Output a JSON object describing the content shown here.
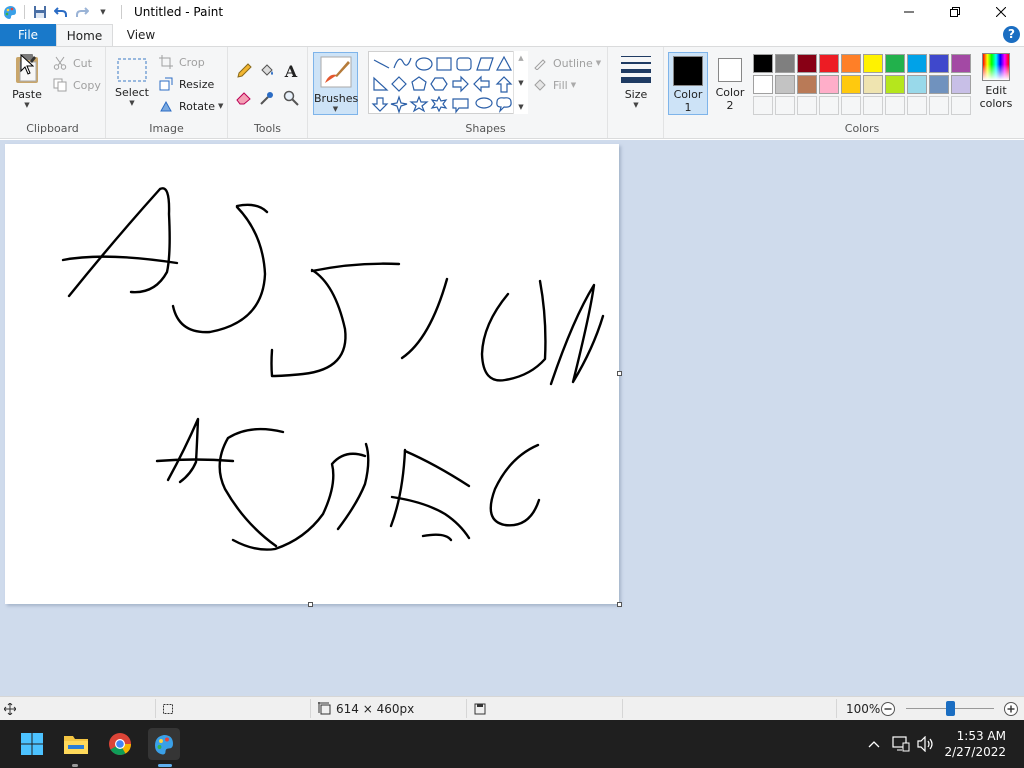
{
  "window": {
    "title": "Untitled - Paint"
  },
  "tabs": {
    "file": "File",
    "home": "Home",
    "view": "View",
    "help": "?"
  },
  "clipboard": {
    "paste": "Paste",
    "cut": "Cut",
    "copy": "Copy",
    "label": "Clipboard"
  },
  "image": {
    "select": "Select",
    "crop": "Crop",
    "resize": "Resize",
    "rotate": "Rotate",
    "label": "Image"
  },
  "tools": {
    "label": "Tools",
    "text_tool": "A"
  },
  "brushes": {
    "label": "Brushes"
  },
  "shapes": {
    "label": "Shapes",
    "outline": "Outline",
    "fill": "Fill"
  },
  "size": {
    "label": "Size"
  },
  "colors": {
    "color1_line1": "Color",
    "color1_line2": "1",
    "color2_line1": "Color",
    "color2_line2": "2",
    "edit_line1": "Edit",
    "edit_line2": "colors",
    "label": "Colors",
    "color1": "#000000",
    "color2": "#ffffff",
    "palette_row1": [
      "#000000",
      "#7f7f7f",
      "#880015",
      "#ed1c24",
      "#ff7f27",
      "#fff200",
      "#22b14c",
      "#00a2e8",
      "#3f48cc",
      "#a349a4"
    ],
    "palette_row2": [
      "#ffffff",
      "#c3c3c3",
      "#b97a57",
      "#ffaec9",
      "#ffc90e",
      "#efe4b0",
      "#b5e61d",
      "#99d9ea",
      "#7092be",
      "#c8bfe7"
    ]
  },
  "status": {
    "canvas_size": "614 × 460px",
    "zoom": "100%",
    "zoom_level": 0.5
  },
  "taskbar": {
    "time": "1:53 AM",
    "date": "2/27/2022"
  }
}
